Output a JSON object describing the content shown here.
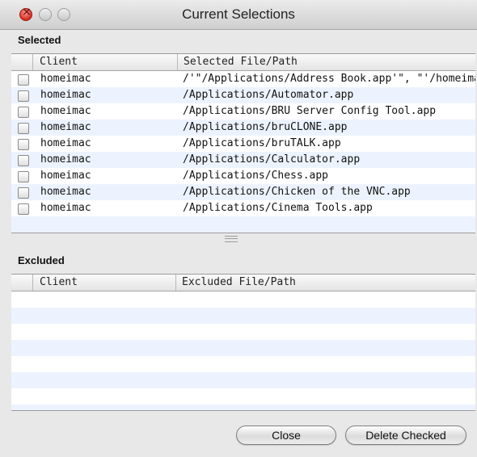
{
  "window": {
    "title": "Current Selections"
  },
  "selected": {
    "heading": "Selected",
    "columns": [
      "Client",
      "Selected File/Path"
    ],
    "rows": [
      {
        "client": "homeimac",
        "path": "/'\"/Applications/Address Book.app'\", \"'/homeima..."
      },
      {
        "client": "homeimac",
        "path": "/Applications/Automator.app"
      },
      {
        "client": "homeimac",
        "path": "/Applications/BRU Server Config Tool.app"
      },
      {
        "client": "homeimac",
        "path": "/Applications/bruCLONE.app"
      },
      {
        "client": "homeimac",
        "path": "/Applications/bruTALK.app"
      },
      {
        "client": "homeimac",
        "path": "/Applications/Calculator.app"
      },
      {
        "client": "homeimac",
        "path": "/Applications/Chess.app"
      },
      {
        "client": "homeimac",
        "path": "/Applications/Chicken of the VNC.app"
      },
      {
        "client": "homeimac",
        "path": "/Applications/Cinema Tools.app"
      }
    ]
  },
  "excluded": {
    "heading": "Excluded",
    "columns": [
      "Client",
      "Excluded File/Path"
    ],
    "rows": []
  },
  "buttons": {
    "close": "Close",
    "delete_checked": "Delete Checked"
  }
}
